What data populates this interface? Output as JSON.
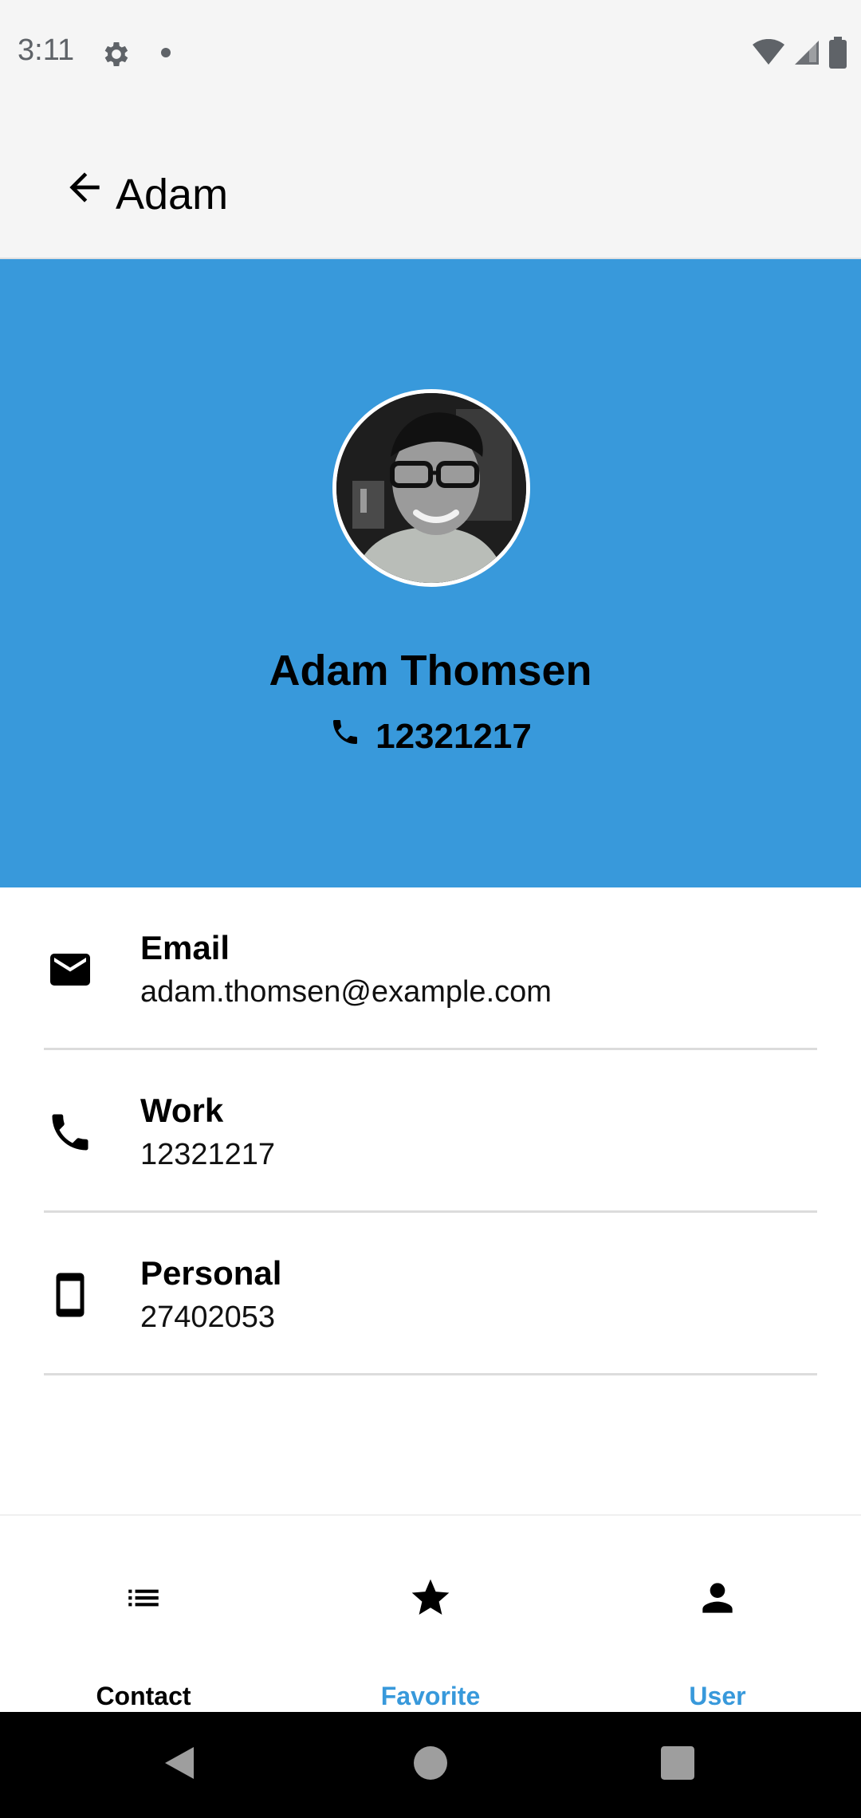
{
  "status_bar": {
    "time": "3:11"
  },
  "app_bar": {
    "title": "Adam"
  },
  "profile": {
    "name": "Adam Thomsen",
    "phone": "12321217"
  },
  "details": [
    {
      "label": "Email",
      "value": "adam.thomsen@example.com",
      "icon": "email-icon"
    },
    {
      "label": "Work",
      "value": "12321217",
      "icon": "phone-icon"
    },
    {
      "label": "Personal",
      "value": "27402053",
      "icon": "smartphone-icon"
    }
  ],
  "bottom_nav": {
    "items": [
      {
        "label": "Contact",
        "icon": "list-icon",
        "color": "#000000"
      },
      {
        "label": "Favorite",
        "icon": "star-icon",
        "color": "#3899db"
      },
      {
        "label": "User",
        "icon": "person-icon",
        "color": "#3899db"
      }
    ]
  },
  "colors": {
    "accent": "#3899db",
    "app_bar_bg": "#f5f5f5",
    "system_nav_bg": "#000000"
  }
}
